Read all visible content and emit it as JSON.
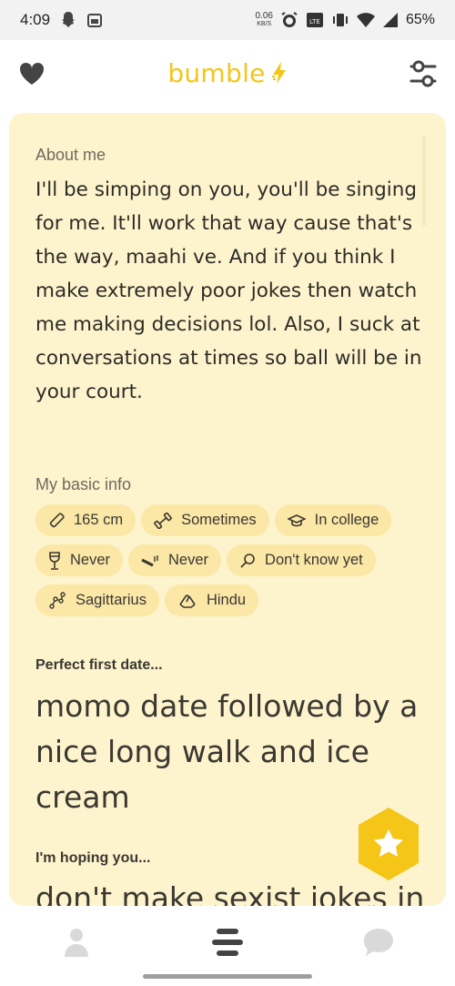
{
  "status_bar": {
    "time": "4:09",
    "net_speed_value": "0.06",
    "net_speed_unit": "KB/S",
    "battery": "65%",
    "icons": [
      "snapchat-icon",
      "calendar-icon",
      "alarm-icon",
      "volte-icon",
      "vibrate-icon",
      "wifi-icon",
      "signal-icon",
      "battery-icon"
    ]
  },
  "header": {
    "logo_text": "bumble",
    "left_icon": "heart-icon",
    "right_icon": "filter-icon",
    "brand_color": "#f5c518"
  },
  "profile": {
    "about_label": "About me",
    "about_text": "I'll be simping on you, you'll be singing for me. It'll work that way cause that's the way, maahi ve. And if you think I make extremely poor jokes then watch me making decisions lol. Also, I suck at conversations at times so ball will be in your court.",
    "basic_info_label": "My basic info",
    "basic_info": [
      {
        "icon": "ruler-icon",
        "label": "165 cm"
      },
      {
        "icon": "dumbbell-icon",
        "label": "Sometimes"
      },
      {
        "icon": "graduation-cap-icon",
        "label": "In college"
      },
      {
        "icon": "wine-glass-icon",
        "label": "Never"
      },
      {
        "icon": "smoking-icon",
        "label": "Never"
      },
      {
        "icon": "magnifier-icon",
        "label": "Don't know yet"
      },
      {
        "icon": "zodiac-icon",
        "label": "Sagittarius"
      },
      {
        "icon": "praying-hands-icon",
        "label": "Hindu"
      }
    ],
    "prompt1_label": "Perfect first date...",
    "prompt1_answer": "momo date followed by a nice long walk and ice cream",
    "prompt2_label": "I'm hoping you...",
    "prompt2_answer": "don't make sexist jokes in",
    "card_color": "#fdf4cd",
    "chip_color": "#fbe7a6"
  },
  "bottom_nav": {
    "items": [
      "profile-icon",
      "people-icon",
      "chat-icon"
    ]
  }
}
